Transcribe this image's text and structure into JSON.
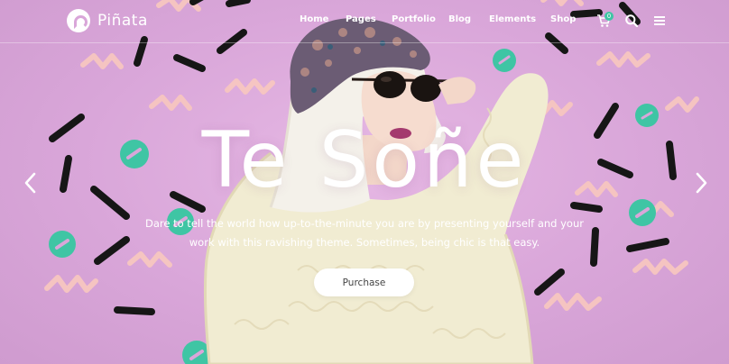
{
  "brand": {
    "name": "Piñata"
  },
  "nav": {
    "items": [
      "Home",
      "Pages",
      "Portfolio",
      "Blog",
      "Elements",
      "Shop"
    ]
  },
  "header_icons": {
    "cart": "cart-icon",
    "cart_count": "0",
    "search": "search-icon",
    "menu": "hamburger-menu-icon"
  },
  "hero": {
    "title": "Te Soñe",
    "subtitle_line1": "Dare to tell the world how up-to-the-minute you are by presenting yourself and your",
    "subtitle_line2": "work with this ravishing theme. Sometimes, being chic is that easy.",
    "button_label": "Purchase"
  },
  "slider": {
    "prev": "chevron-left-icon",
    "next": "chevron-right-icon"
  },
  "colors": {
    "background": "#d9a6d9",
    "accent_teal": "#3fc5a4",
    "accent_peach": "#f7c6c0",
    "stroke_dark": "#1a1a1a"
  }
}
